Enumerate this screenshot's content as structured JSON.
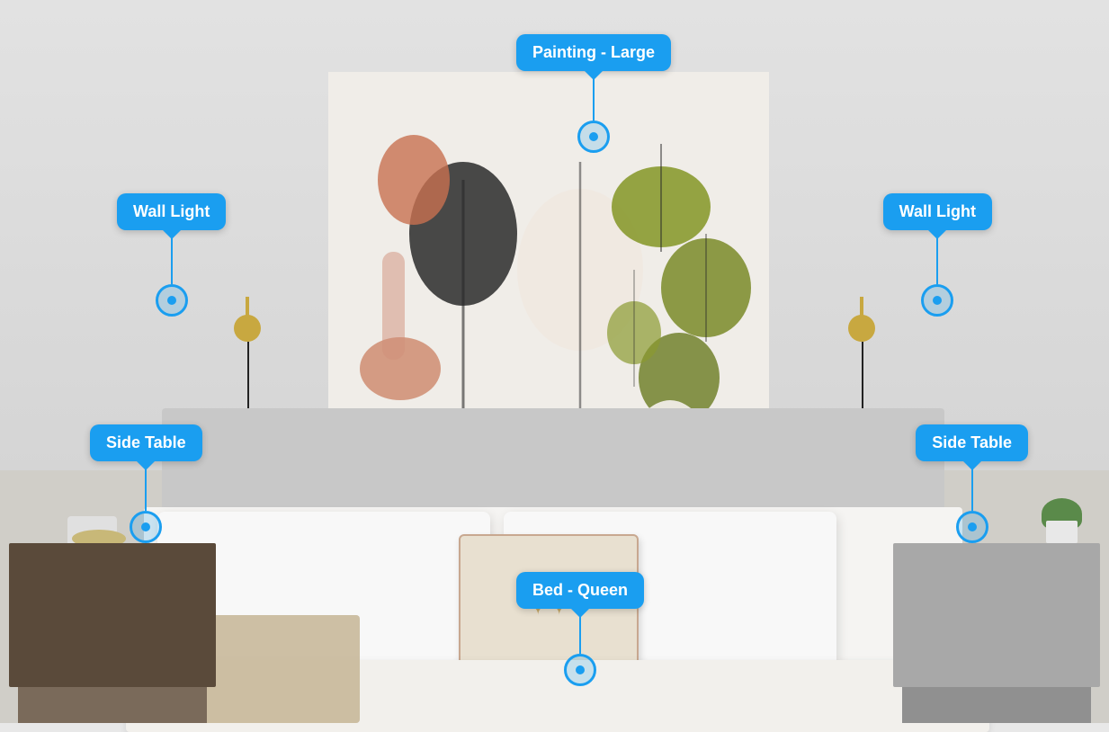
{
  "scene": {
    "background_color": "#d9d9d9",
    "wall_color": "#e0e0e0",
    "floor_color": "#d0cec8"
  },
  "annotations": {
    "painting": {
      "label": "Painting - Large",
      "position": "top-center"
    },
    "wall_light_left": {
      "label": "Wall Light",
      "position": "left"
    },
    "wall_light_right": {
      "label": "Wall Light",
      "position": "right"
    },
    "side_table_left": {
      "label": "Side Table",
      "position": "left"
    },
    "side_table_right": {
      "label": "Side Table",
      "position": "right"
    },
    "bed": {
      "label": "Bed - Queen",
      "position": "bottom-center"
    }
  },
  "colors": {
    "accent_blue": "#1a9ef0",
    "sconce_gold": "#c8a840",
    "label_text": "#ffffff"
  }
}
